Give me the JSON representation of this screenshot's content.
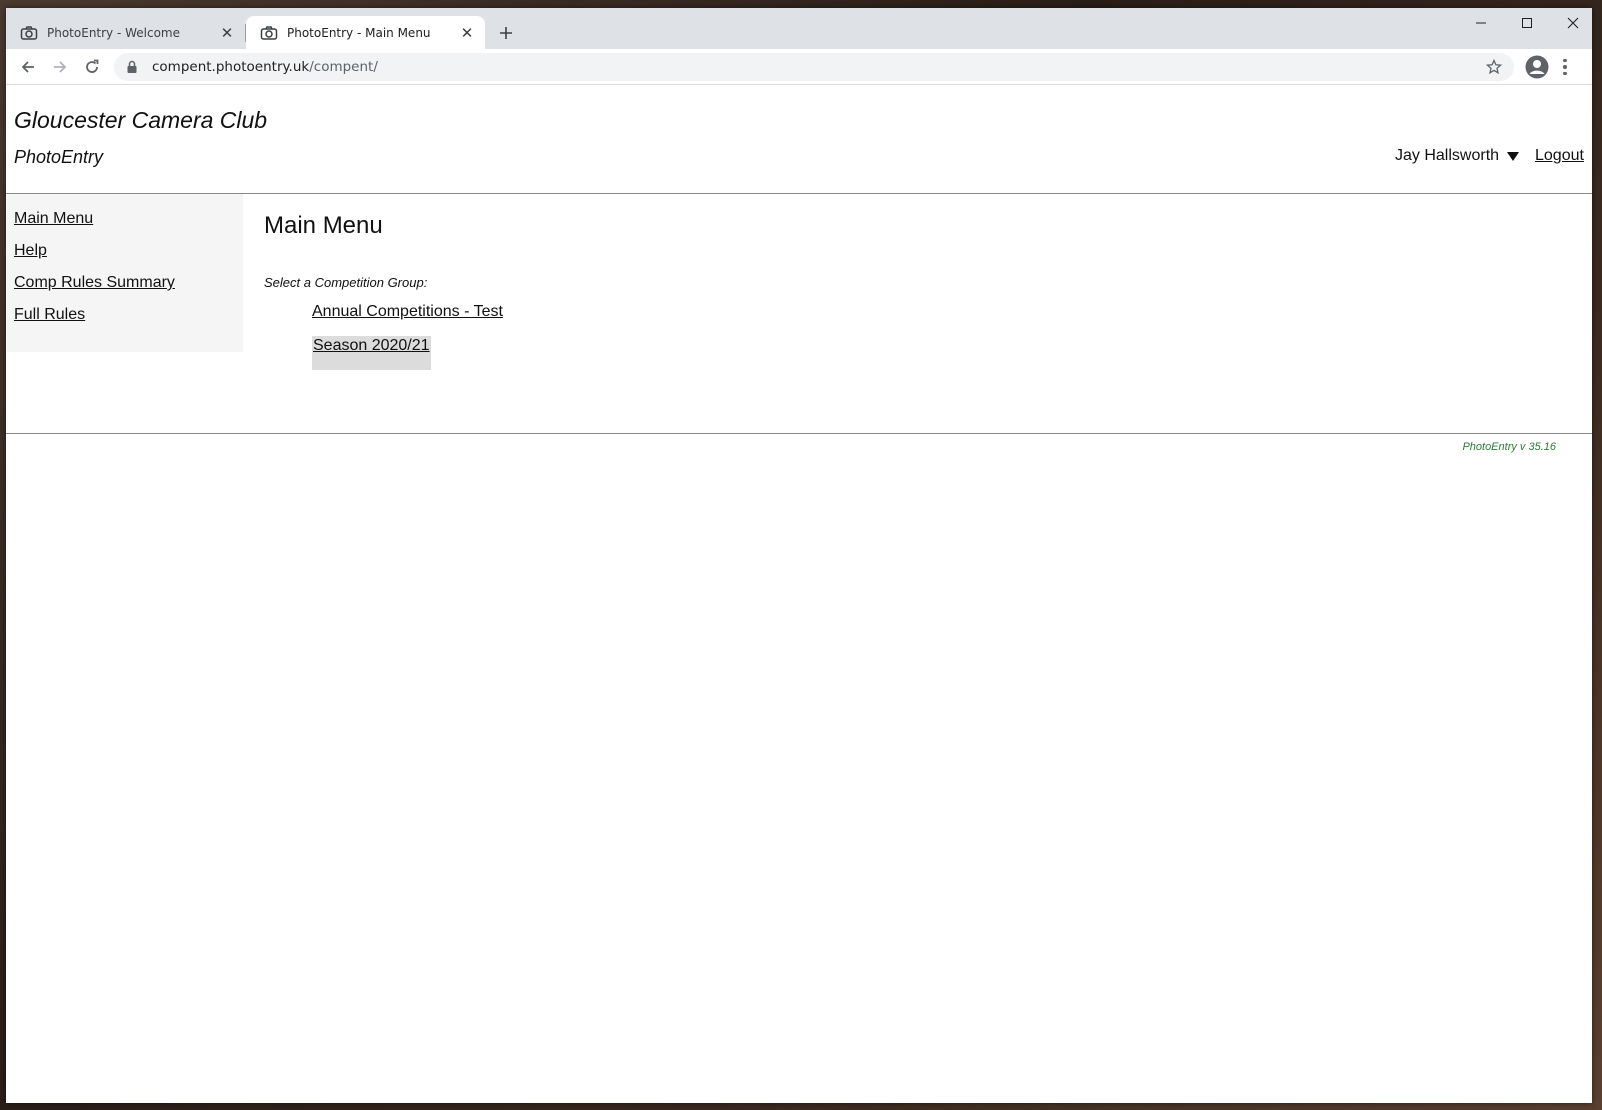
{
  "browser": {
    "tabs": [
      {
        "title": "PhotoEntry - Welcome",
        "icon": "camera-icon",
        "active": false
      },
      {
        "title": "PhotoEntry - Main Menu",
        "icon": "camera-icon",
        "active": true
      }
    ],
    "url_host": "compent.photoentry.uk",
    "url_path": "/compent/"
  },
  "header": {
    "club_name": "Gloucester Camera Club",
    "app_name": "PhotoEntry",
    "user_name": "Jay Hallsworth",
    "logout_label": "Logout"
  },
  "sidebar": {
    "items": [
      {
        "label": "Main Menu"
      },
      {
        "label": "Help"
      },
      {
        "label": "Comp Rules Summary"
      },
      {
        "label": "Full Rules"
      }
    ]
  },
  "main": {
    "title": "Main Menu",
    "select_label": "Select a Competition Group:",
    "groups": [
      {
        "label": "Annual Competitions - Test"
      },
      {
        "label": "Season 2020/21"
      }
    ]
  },
  "footer": {
    "version": "PhotoEntry v 35.16",
    "version_color": "#2e7d32"
  }
}
